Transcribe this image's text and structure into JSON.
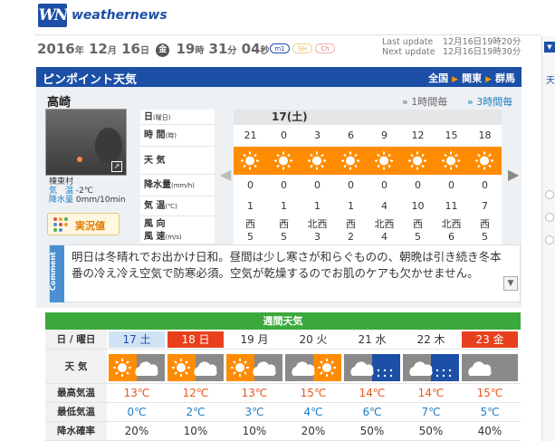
{
  "header": {
    "logo_text": "WN",
    "brand": "weathernews"
  },
  "datebar": {
    "year": "2016",
    "year_unit": "年",
    "month": "12",
    "month_unit": "月",
    "day": "16",
    "day_unit": "日",
    "weekday": "金",
    "hour": "19",
    "hour_unit": "時",
    "minute": "31",
    "minute_unit": "分",
    "second": "04",
    "second_unit": "秒",
    "badges": [
      "m1",
      "SH",
      "Ch"
    ],
    "last_update_label": "Last update",
    "last_update_value": "12月16日19時20分",
    "next_update_label": "Next update",
    "next_update_value": "12月16日19時30分"
  },
  "pinpoint": {
    "title": "ピンポイント天気",
    "breadcrumbs": [
      "全国",
      "関東",
      "群馬"
    ],
    "city": "高崎",
    "step_1h": "1時間毎",
    "step_3h": "3時間毎",
    "observation": {
      "station": "棟東村",
      "temp_label": "気　温",
      "temp": "-2℃",
      "precip_label": "降水量",
      "precip": "0mm/10min"
    },
    "jikkyo_label": "実況値",
    "row_labels": [
      {
        "main": "日",
        "unit": "(曜日)"
      },
      {
        "main": "時 間",
        "unit": "(時)"
      },
      {
        "main": "天 気",
        "unit": ""
      },
      {
        "main": "降水量",
        "unit": "(mm/h)"
      },
      {
        "main": "気 温",
        "unit": "(℃)"
      },
      {
        "main": "風 向",
        "unit": ""
      },
      {
        "main": "風 速",
        "unit": "(m/s)"
      }
    ],
    "day_label": "17(土)",
    "hours": [
      "21",
      "0",
      "3",
      "6",
      "9",
      "12",
      "15",
      "18"
    ],
    "weather": [
      "sun-icon",
      "sun-icon",
      "sun-icon",
      "sun-icon",
      "sun-icon",
      "sun-icon",
      "sun-icon",
      "sun-icon"
    ],
    "precip": [
      "0",
      "0",
      "0",
      "0",
      "0",
      "0",
      "0",
      "0"
    ],
    "temps": [
      "1",
      "1",
      "1",
      "1",
      "4",
      "10",
      "11",
      "7"
    ],
    "wind_dir": [
      "西",
      "西",
      "北西",
      "西",
      "北西",
      "西",
      "北西",
      "西"
    ],
    "wind_speed": [
      "5",
      "5",
      "3",
      "2",
      "4",
      "5",
      "6",
      "5"
    ],
    "comment_tag": "Comment",
    "comment": "明日は冬晴れでお出かけ日和。昼間は少し寒さが和らぐものの、朝晩は引き続き冬本番の冷え冷え空気で防寒必須。空気が乾燥するのでお肌のケアも欠かせません。"
  },
  "weekly": {
    "title": "週間天気",
    "date_label": "日 / 曜日",
    "weather_label": "天 気",
    "max_label": "最高気温",
    "min_label": "最低気温",
    "pop_label": "降水確率",
    "days": [
      {
        "date": "17",
        "wd": "土",
        "max": "13℃",
        "min": "0℃",
        "pop": "20%",
        "icon": "sun-cloud-icon"
      },
      {
        "date": "18",
        "wd": "日",
        "max": "12℃",
        "min": "2℃",
        "pop": "10%",
        "icon": "sun-cloud-icon"
      },
      {
        "date": "19",
        "wd": "月",
        "max": "13℃",
        "min": "3℃",
        "pop": "10%",
        "icon": "sun-cloud-icon"
      },
      {
        "date": "20",
        "wd": "火",
        "max": "15℃",
        "min": "4℃",
        "pop": "20%",
        "icon": "cloud-sun-icon"
      },
      {
        "date": "21",
        "wd": "水",
        "max": "14℃",
        "min": "6℃",
        "pop": "50%",
        "icon": "cloud-rain-icon"
      },
      {
        "date": "22",
        "wd": "木",
        "max": "14℃",
        "min": "7℃",
        "pop": "50%",
        "icon": "cloud-rain-icon"
      },
      {
        "date": "23",
        "wd": "金",
        "max": "15℃",
        "min": "5℃",
        "pop": "40%",
        "icon": "cloud-icon"
      }
    ]
  },
  "right_panel": {
    "label": "天"
  },
  "colors": {
    "brand_blue": "#1c4fa6",
    "orange": "#ff8c00",
    "green": "#3ba93b",
    "max_temp": "#e8561a",
    "min_temp": "#1c7ec4"
  }
}
